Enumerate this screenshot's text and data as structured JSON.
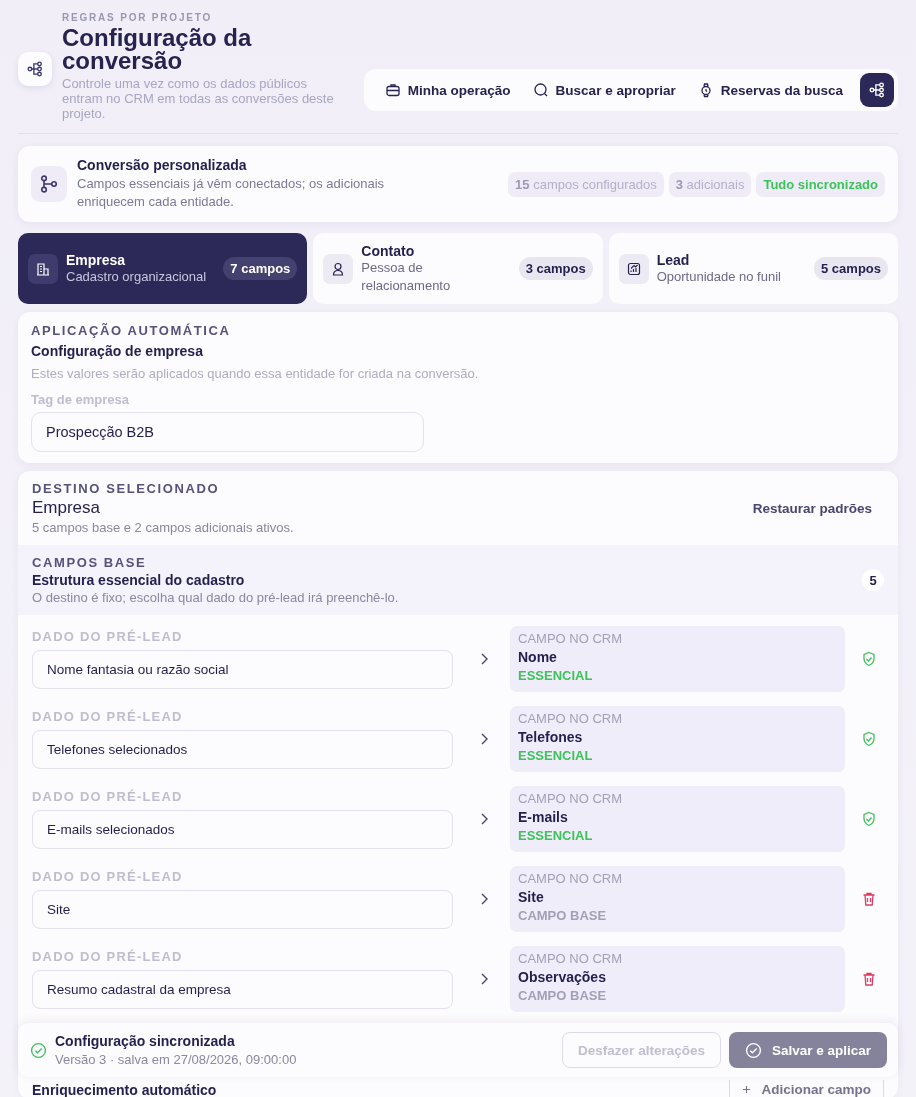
{
  "header": {
    "eyebrow": "REGRAS POR PROJETO",
    "title": "Configuração da conversão",
    "description": "Controle uma vez como os dados públicos entram no CRM em todas as conversões deste projeto."
  },
  "nav": [
    {
      "label": "Minha operação"
    },
    {
      "label": "Buscar e apropriar"
    },
    {
      "label": "Reservas da busca"
    }
  ],
  "summary": {
    "title": "Conversão personalizada",
    "description": "Campos essenciais já vêm conectados; os adicionais enriquecem cada entidade.",
    "badges": [
      {
        "text": "**15** campos configurados",
        "kind": "neutral"
      },
      {
        "text": "**3** adicionais",
        "kind": "neutral"
      },
      {
        "text": "Tudo sincronizado",
        "kind": "success"
      }
    ]
  },
  "entities": [
    {
      "name": "Empresa",
      "subtitle": "Cadastro organizacional",
      "count": "7 campos",
      "selected": true
    },
    {
      "name": "Contato",
      "subtitle": "Pessoa de relacionamento",
      "count": "3 campos",
      "selected": false
    },
    {
      "name": "Lead",
      "subtitle": "Oportunidade no funil",
      "count": "5 campos",
      "selected": false
    }
  ],
  "auto_apply": {
    "eyebrow": "APLICAÇÃO AUTOMÁTICA",
    "title": "Configuração de empresa",
    "description": "Estes valores serão aplicados quando essa entidade for criada na conversão.",
    "field_label": "Tag de empresa",
    "field_value": "Prospecção B2B"
  },
  "destination": {
    "eyebrow": "DESTINO SELECIONADO",
    "name": "Empresa",
    "summary": "5 campos base e 2 campos adicionais ativos.",
    "reset": "Restaurar padrões"
  },
  "base_fields": {
    "eyebrow": "CAMPOS BASE",
    "title": "Estrutura essencial do cadastro",
    "description": "O destino é fixo; escolha qual dado do pré-lead irá preenchê-lo.",
    "count": "5",
    "rows": [
      {
        "source_label": "DADO DO PRÉ-LEAD",
        "source_value": "Nome fantasia ou razão social",
        "crm_label": "CAMPO NO CRM",
        "crm_name": "Nome",
        "tag": "ESSENCIAL",
        "kind": "essential"
      },
      {
        "source_label": "DADO DO PRÉ-LEAD",
        "source_value": "Telefones selecionados",
        "crm_label": "CAMPO NO CRM",
        "crm_name": "Telefones",
        "tag": "ESSENCIAL",
        "kind": "essential"
      },
      {
        "source_label": "DADO DO PRÉ-LEAD",
        "source_value": "E-mails selecionados",
        "crm_label": "CAMPO NO CRM",
        "crm_name": "E-mails",
        "tag": "ESSENCIAL",
        "kind": "essential"
      },
      {
        "source_label": "DADO DO PRÉ-LEAD",
        "source_value": "Site",
        "crm_label": "CAMPO NO CRM",
        "crm_name": "Site",
        "tag": "CAMPO BASE",
        "kind": "base"
      },
      {
        "source_label": "DADO DO PRÉ-LEAD",
        "source_value": "Resumo cadastral da empresa",
        "crm_label": "CAMPO NO CRM",
        "crm_name": "Observações",
        "tag": "CAMPO BASE",
        "kind": "base"
      }
    ]
  },
  "next_section": {
    "title": "Enriquecimento automático",
    "button": "Adicionar campo"
  },
  "sync_bar": {
    "title": "Configuração sincronizada",
    "version": "Versão 3 · salva em 27/08/2026, 09:00:00",
    "undo": "Desfazer alterações",
    "save": "Salvar e aplicar"
  }
}
